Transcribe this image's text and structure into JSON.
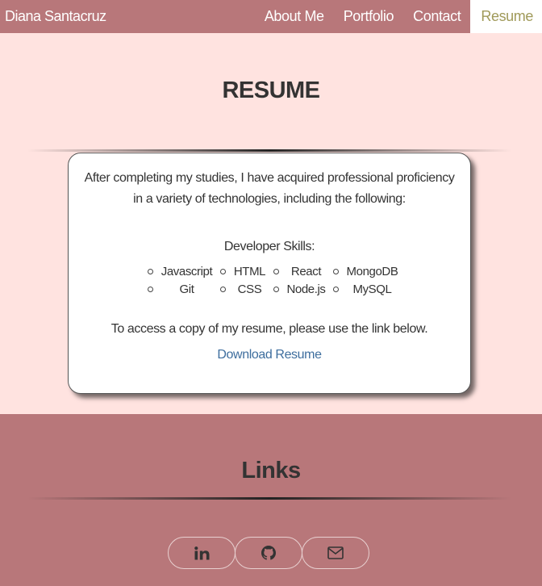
{
  "nav": {
    "brand": "Diana Santacruz",
    "links": [
      "About Me",
      "Portfolio",
      "Contact",
      "Resume"
    ],
    "active": "Resume",
    "active_color": "#a09a5a"
  },
  "resume": {
    "title": "RESUME",
    "intro": "After completing my studies, I have acquired professional proficiency in a variety of technologies, including the following:",
    "skills_heading": "Developer Skills:",
    "skills": [
      "Javascript",
      "HTML",
      "React",
      "MongoDB",
      "Git",
      "CSS",
      "Node.js",
      "MySQL"
    ],
    "access_text": "To access a copy of my resume, please use the link below.",
    "download_label": "Download Resume",
    "link_color": "#3e6e9e"
  },
  "links": {
    "title": "Links",
    "icons": [
      "linkedin-icon",
      "github-icon",
      "envelope-icon"
    ]
  },
  "colors": {
    "nav_background": "#b8777a",
    "page_background": "#ffe3e0",
    "card_background": "#ffffff"
  }
}
